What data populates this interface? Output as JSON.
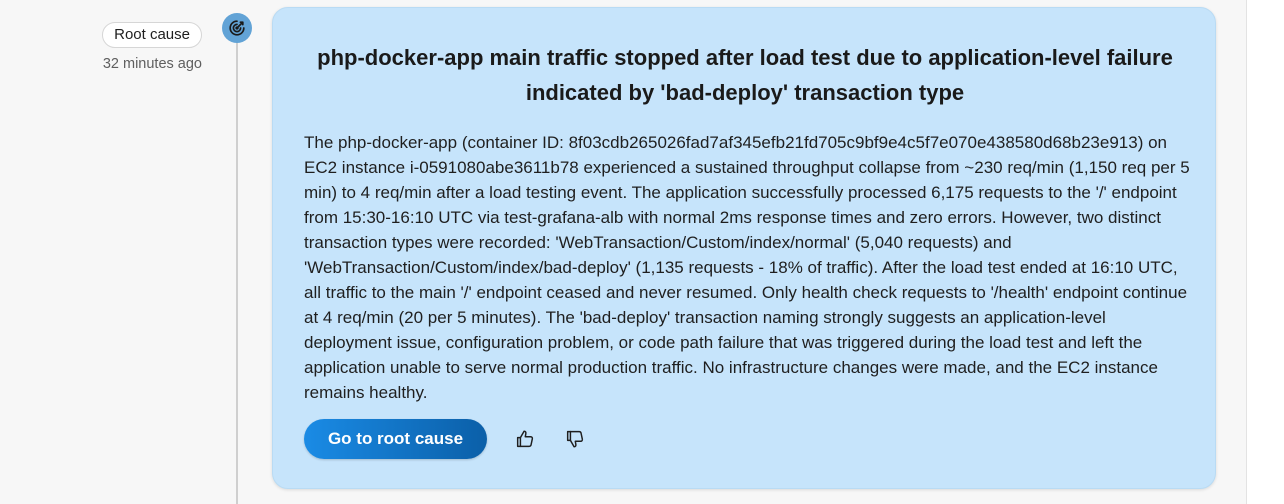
{
  "entry": {
    "tag_label": "Root cause",
    "timestamp": "32 minutes ago",
    "node_icon": "target-arrow-icon"
  },
  "card": {
    "title": "php-docker-app main traffic stopped after load test due to application-level failure indicated by 'bad-deploy' transaction type",
    "body": "The php-docker-app (container ID: 8f03cdb265026fad7af345efb21fd705c9bf9e4c5f7e070e438580d68b23e913) on EC2 instance i-0591080abe3611b78 experienced a sustained throughput collapse from ~230 req/min (1,150 req per 5 min) to 4 req/min after a load testing event. The application successfully processed 6,175 requests to the '/' endpoint from 15:30-16:10 UTC via test-grafana-alb with normal 2ms response times and zero errors. However, two distinct transaction types were recorded: 'WebTransaction/Custom/index/normal' (5,040 requests) and 'WebTransaction/Custom/index/bad-deploy' (1,135 requests - 18% of traffic). After the load test ended at 16:10 UTC, all traffic to the main '/' endpoint ceased and never resumed. Only health check requests to '/health' endpoint continue at 4 req/min (20 per 5 minutes). The 'bad-deploy' transaction naming strongly suggests an application-level deployment issue, configuration problem, or code path failure that was triggered during the load test and left the application unable to serve normal production traffic. No infrastructure changes were made, and the EC2 instance remains healthy.",
    "primary_button_label": "Go to root cause",
    "feedback_icons": [
      "thumbs-up-icon",
      "thumbs-down-icon"
    ]
  },
  "colors": {
    "card_background": "#c6e4fb",
    "button_gradient_start": "#1a8be5",
    "button_gradient_end": "#0b5fa8",
    "timeline_node": "#62a3d6"
  }
}
